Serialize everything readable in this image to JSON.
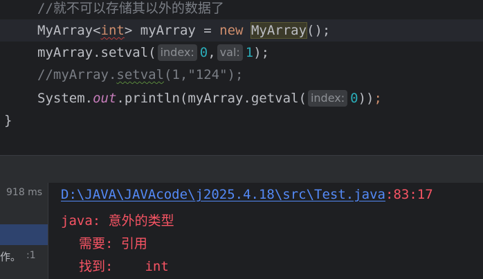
{
  "editor": {
    "lines": [
      {
        "comment": "//就不可以存储其以外的数据了"
      },
      {
        "class1": "MyArray",
        "lt": "<",
        "generic": "int",
        "gt": ">",
        "var_decl": " myArray = ",
        "kw_new": "new",
        "space": " ",
        "class2": "MyArray",
        "tail": "();"
      },
      {
        "prefix": "myArray.setval(",
        "hint1": "index:",
        "arg1": "0",
        "comma": ",",
        "hint2": "val:",
        "arg2": "1",
        "tail": ");"
      },
      {
        "c_prefix": "//myArray.",
        "c_method": "setval",
        "c_tail": "(1,\"124\");"
      },
      {
        "system": "System.",
        "out": "out",
        "call": ".println(myArray.getval(",
        "hint": "index:",
        "arg": "0",
        "tail": "))",
        "semi": ";"
      },
      {
        "brace": "}"
      }
    ]
  },
  "run_panel": {
    "timing": "918 ms",
    "tree_label": "作。",
    "tree_count": ":1"
  },
  "console": {
    "error_path": "D:\\JAVA\\JAVAcode\\j2025.4.18\\src\\Test.java",
    "error_location": ":83:17",
    "error_title": "java: 意外的类型",
    "required_label": "需要: 引用",
    "found_label": "找到:",
    "found_value": "int"
  },
  "colors": {
    "editor_bg": "#1e1f22",
    "panel_bg": "#2b2d30",
    "keyword": "#cf8e6d",
    "number": "#2aacb8",
    "comment": "#7a7e85",
    "static_field": "#c77dbb",
    "link": "#548af7",
    "error": "#f75464"
  }
}
